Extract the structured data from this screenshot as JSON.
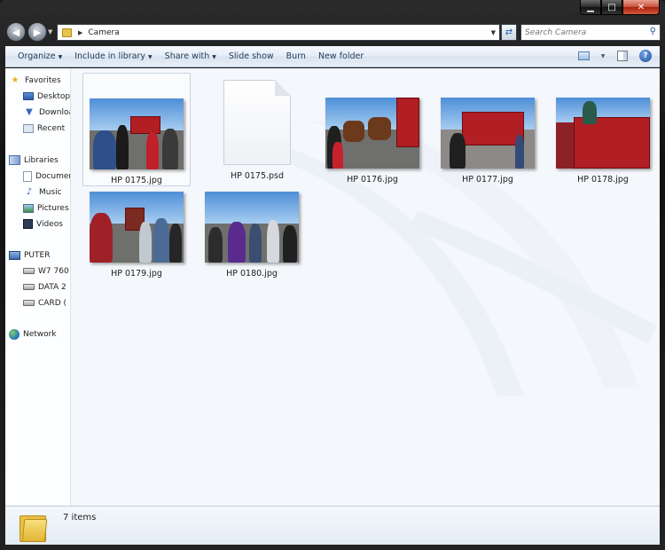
{
  "window": {
    "caption_buttons": [
      "minimize-icon",
      "maximize-icon",
      "close-icon"
    ]
  },
  "address_bar": {
    "breadcrumb": [
      "Camera"
    ]
  },
  "search": {
    "placeholder": "Search Camera"
  },
  "toolbar": {
    "items": [
      {
        "label": "Organize",
        "dropdown": true
      },
      {
        "label": "Include in library",
        "dropdown": true
      },
      {
        "label": "Share with",
        "dropdown": true
      },
      {
        "label": "Slide show",
        "dropdown": false
      },
      {
        "label": "Burn",
        "dropdown": false
      },
      {
        "label": "New folder",
        "dropdown": false
      }
    ],
    "right_icons": [
      "views-icon",
      "preview-pane-icon",
      "help-icon"
    ],
    "help_label": "?"
  },
  "nav_pane": {
    "favorites": {
      "label": "Favorites",
      "items": [
        "Desktop",
        "Downloads",
        "Recent"
      ]
    },
    "libraries": {
      "label": "Libraries",
      "items": [
        "Documents",
        "Music",
        "Pictures",
        "Videos"
      ]
    },
    "computer": {
      "label": "PUTER",
      "items": [
        "W7 760",
        "DATA 2",
        "CARD ("
      ]
    },
    "network": {
      "label": "Network"
    }
  },
  "files": [
    {
      "name": "HP 0175.jpg",
      "type": "jpg",
      "selected": true
    },
    {
      "name": "HP 0175.psd",
      "type": "psd",
      "selected": false
    },
    {
      "name": "HP 0176.jpg",
      "type": "jpg",
      "selected": false
    },
    {
      "name": "HP 0177.jpg",
      "type": "jpg",
      "selected": false
    },
    {
      "name": "HP 0178.jpg",
      "type": "jpg",
      "selected": false
    },
    {
      "name": "HP 0179.jpg",
      "type": "jpg",
      "selected": false
    },
    {
      "name": "HP 0180.jpg",
      "type": "jpg",
      "selected": false
    }
  ],
  "details_pane": {
    "item_count": "7 items"
  },
  "colors": {
    "accent": "#1e395b",
    "folder": "#e8c044",
    "selection": "#c8d3df"
  }
}
